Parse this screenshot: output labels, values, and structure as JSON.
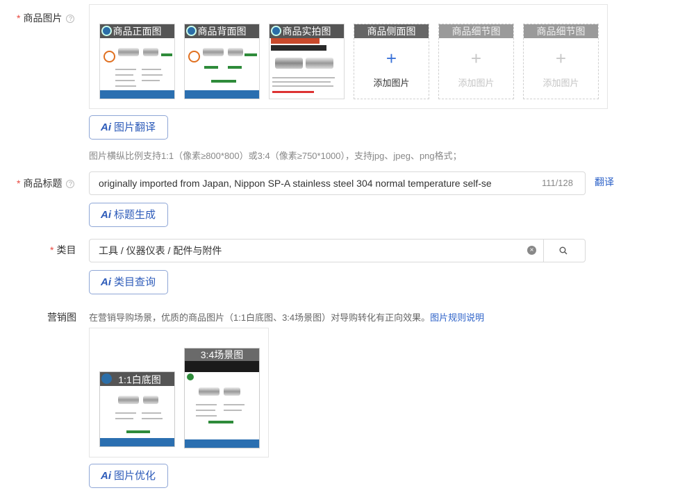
{
  "product_images": {
    "label": "商品图片",
    "required": "*",
    "help": "?",
    "tiles": [
      {
        "caption": "商品正面图"
      },
      {
        "caption": "商品背面图"
      },
      {
        "caption": "商品实拍图"
      }
    ],
    "add_tiles": [
      {
        "caption": "商品侧面图",
        "plus": "+",
        "text": "添加图片"
      },
      {
        "caption": "商品细节图",
        "plus": "+",
        "text": "添加图片"
      },
      {
        "caption": "商品细节图",
        "plus": "+",
        "text": "添加图片"
      }
    ],
    "ai_button": {
      "ai": "Ai",
      "label": "图片翻译"
    },
    "hint": "图片横纵比例支持1:1（像素≥800*800）或3:4（像素≥750*1000），支持jpg、jpeg、png格式；"
  },
  "title": {
    "label": "商品标题",
    "required": "*",
    "help": "?",
    "value": "originally imported from Japan, Nippon SP-A stainless steel 304 normal temperature self-se",
    "counter": "111/128",
    "translate_link": "翻译",
    "ai_button": {
      "ai": "Ai",
      "label": "标题生成"
    }
  },
  "category": {
    "label": "类目",
    "required": "*",
    "value": "工具 / 仪器仪表 / 配件与附件",
    "clear": "×",
    "ai_button": {
      "ai": "Ai",
      "label": "类目查询"
    }
  },
  "marketing": {
    "label": "营销图",
    "desc": "在营销导购场景，优质的商品图片（1:1白底图、3:4场景图）对导购转化有正向效果。",
    "rules_link": "图片规则说明",
    "tiles": [
      {
        "caption": "1:1白底图"
      },
      {
        "caption": "3:4场景图"
      }
    ],
    "ai_button": {
      "ai": "Ai",
      "label": "图片优化"
    }
  }
}
